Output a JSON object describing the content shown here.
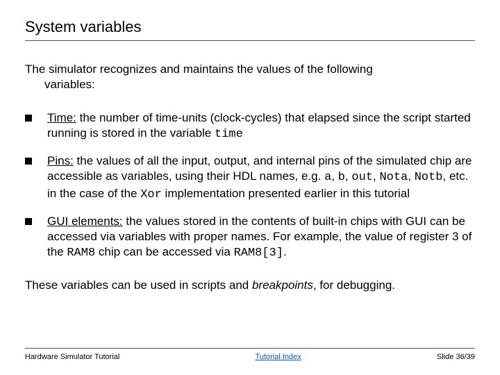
{
  "title": "System variables",
  "intro_l1": "The simulator recognizes and maintains the values of the following",
  "intro_l2": "variables:",
  "bullets": [
    {
      "label": "Time:",
      "t1": " the number of time-units (clock-cycles) that elapsed since the script started running is stored in the variable ",
      "c1": "time"
    },
    {
      "label": "Pins:",
      "t1": " the values of all the input, output, and internal pins of the simulated chip are accessible as variables, using their HDL names, e.g. ",
      "c1": "a",
      "s1": ", ",
      "c2": "b",
      "s2": ", ",
      "c3": "out",
      "s3": ", ",
      "c4": "Nota",
      "s4": ", ",
      "c5": "Notb",
      "s5": ", etc. in the case of the ",
      "c6": "Xor",
      "s6": " implementation presented earlier in this tutorial"
    },
    {
      "label": "GUI elements:",
      "t1": " the values stored in the contents of built-in chips with GUI can be accessed via variables with proper names.  For example, the value of register 3 of the ",
      "c1": "RAM8",
      "s1": " chip can be accessed via ",
      "c2": "RAM8[3]",
      "s2": "."
    }
  ],
  "closing_pre": "These variables can be used in scripts and ",
  "closing_em": "breakpoints",
  "closing_post": ", for debugging.",
  "footer": {
    "left": "Hardware Simulator Tutorial",
    "center": "Tutorial Index",
    "right": "Slide 36/39"
  }
}
